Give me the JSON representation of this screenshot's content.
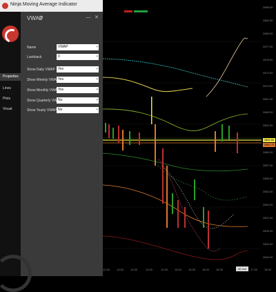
{
  "window": {
    "title": "Ninja Moving Average Indicator"
  },
  "dialog": {
    "header_title": "VWAP",
    "header_count": "0",
    "close_label": "✕",
    "minimize_label": "—",
    "nav": [
      {
        "label": "Properties"
      },
      {
        "label": "Lines"
      },
      {
        "label": "Plots"
      },
      {
        "label": "Visual"
      }
    ],
    "properties": [
      {
        "label": "Name",
        "value": "VWAP"
      },
      {
        "label": "Lookback",
        "value": "0"
      },
      {
        "label": "Show Daily VWAP",
        "value": "Yes"
      },
      {
        "label": "Show Weekly VWAP",
        "value": "Yes"
      },
      {
        "label": "Show Monthly VWAP",
        "value": "Yes"
      },
      {
        "label": "Show Quarterly VWAP",
        "value": "No"
      },
      {
        "label": "Show Yearly VWAP",
        "value": "No"
      }
    ]
  },
  "chart": {
    "price_tags": [
      {
        "label": "2862.50",
        "color": "#f0e64a"
      },
      {
        "label": "2860.75",
        "color": "#e07830"
      }
    ],
    "y_ticks": [
      "2885.00",
      "2882.50",
      "2880.00",
      "2877.50",
      "2875.00",
      "2872.50",
      "2870.00",
      "2867.50",
      "2865.00",
      "2862.50",
      "2860.00",
      "2857.50",
      "2855.00",
      "2852.50",
      "2850.00",
      "2847.50",
      "2845.00",
      "2842.50",
      "2840.00",
      "2837.50"
    ],
    "x_ticks": [
      "12:30",
      "13:00",
      "13:30",
      "14:00",
      "14:30",
      "15:00",
      "15:30",
      "16:00",
      "16:30",
      "17:00",
      "17:30",
      "18:00"
    ],
    "cursor_time": "20 Jun 2019"
  }
}
